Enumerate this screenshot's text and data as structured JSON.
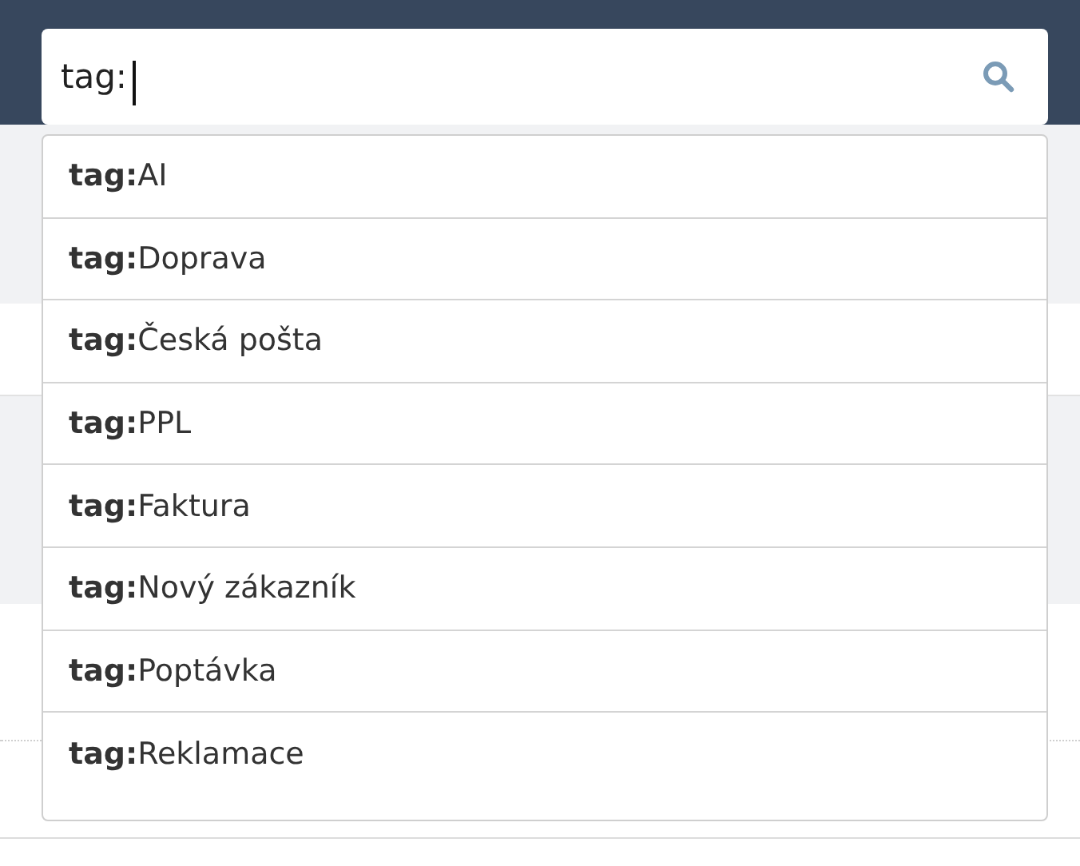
{
  "search": {
    "value": "tag:"
  },
  "suggestions": [
    {
      "label": "**tag:**AI"
    },
    {
      "label": "**tag:**Doprava"
    },
    {
      "label": "**tag:**Česká pošta"
    },
    {
      "label": "**tag:**PPL"
    },
    {
      "label": "**tag:**Faktura"
    },
    {
      "label": "**tag:**Nový zákazník"
    },
    {
      "label": "**tag:**Poptávka"
    },
    {
      "label": "**tag:**Reklamace"
    }
  ]
}
